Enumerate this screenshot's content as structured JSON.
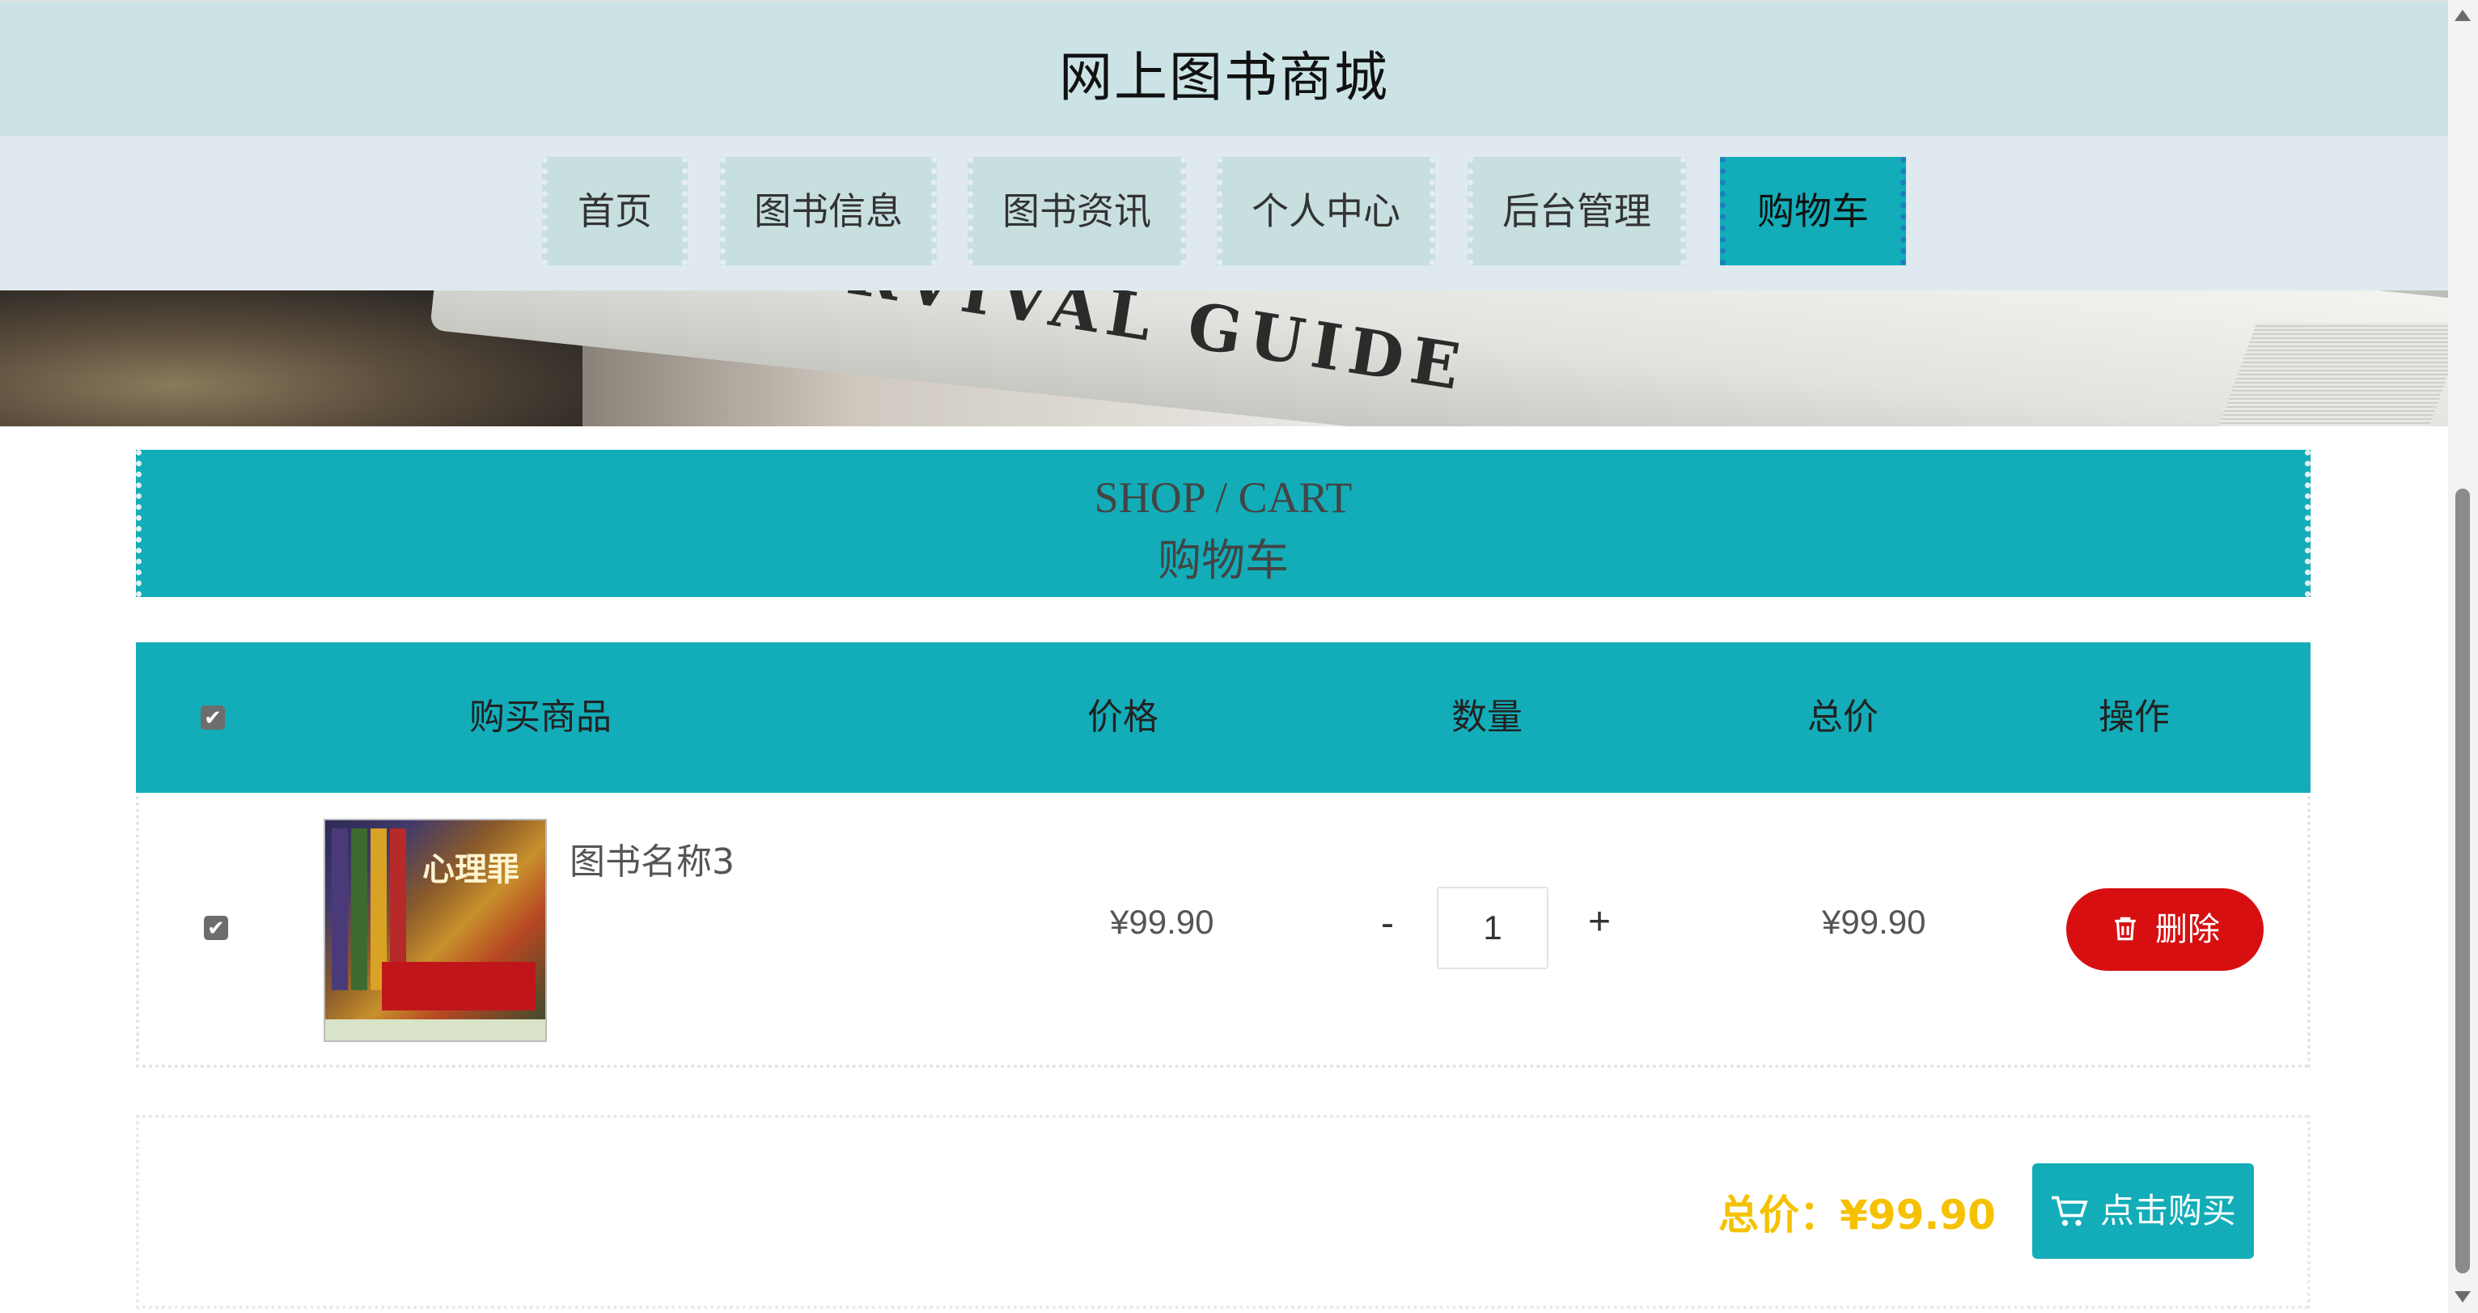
{
  "site": {
    "title": "网上图书商城"
  },
  "nav": {
    "items": [
      {
        "label": "首页",
        "active": false
      },
      {
        "label": "图书信息",
        "active": false
      },
      {
        "label": "图书资讯",
        "active": false
      },
      {
        "label": "个人中心",
        "active": false
      },
      {
        "label": "后台管理",
        "active": false
      },
      {
        "label": "购物车",
        "active": true
      }
    ]
  },
  "banner": {
    "text": "SURVIVAL GUIDE"
  },
  "section": {
    "title_en": "SHOP / CART",
    "title_cn": "购物车"
  },
  "table": {
    "select_all_checked": true,
    "headers": {
      "product": "购买商品",
      "price": "价格",
      "quantity": "数量",
      "total": "总价",
      "action": "操作"
    },
    "rows": [
      {
        "checked": true,
        "name": "图书名称3",
        "cover_title": "心理罪",
        "price": "¥99.90",
        "quantity": "1",
        "total": "¥99.90",
        "delete_label": "删除"
      }
    ],
    "qty_minus": "-",
    "qty_plus": "+"
  },
  "summary": {
    "total_label": "总价：¥99.90",
    "buy_label": "点击购买"
  },
  "colors": {
    "teal": "#12adb8",
    "danger": "#d70f10",
    "total": "#f5c100",
    "header_bg": "#cbe3e4",
    "nav_bg": "#dfe9ef"
  },
  "icons": {
    "delete": "trash-icon",
    "buy": "cart-icon"
  }
}
